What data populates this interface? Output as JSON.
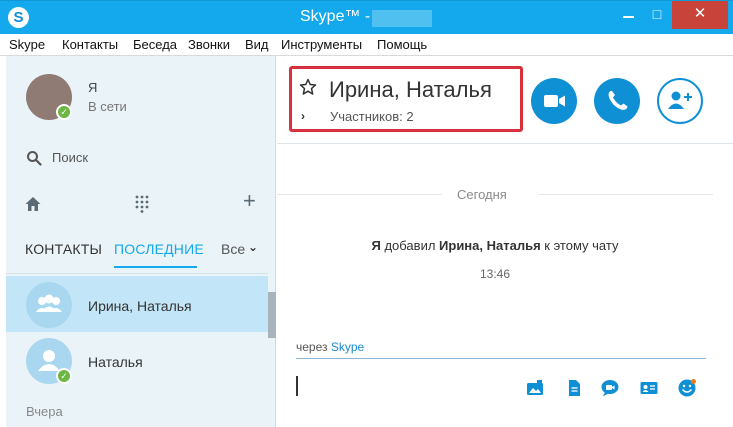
{
  "window": {
    "title": "Skype™ -",
    "app_icon_letter": "S",
    "minimize_label": "",
    "maximize_label": "□",
    "close_label": "✕"
  },
  "menu": {
    "items": [
      "Skype",
      "Контакты",
      "Беседа",
      "Звонки",
      "Вид",
      "Инструменты",
      "Помощь"
    ]
  },
  "profile": {
    "name": "Я",
    "status": "В сети"
  },
  "search": {
    "label": "Поиск"
  },
  "sidebar": {
    "tabs": {
      "contacts": "КОНТАКТЫ",
      "recent": "ПОСЛЕДНИЕ"
    },
    "filter": "Все",
    "recent_items": [
      {
        "name": "Ирина, Наталья",
        "selected": true
      },
      {
        "name": "Наталья",
        "selected": false
      }
    ],
    "section_yesterday": "Вчера"
  },
  "conversation": {
    "title": "Ирина, Наталья",
    "participants": "Участников: 2"
  },
  "chat": {
    "day_label": "Сегодня",
    "event_actor": "Я",
    "event_middle": " добавил ",
    "event_names": "Ирина, Наталья",
    "event_suffix": " к этому чату",
    "event_time": "13:46",
    "via_prefix": "через ",
    "via_link": "Skype"
  },
  "colors": {
    "brand": "#13a9ec",
    "action_button": "#1090d4",
    "highlight_border": "#d9303d",
    "online_status": "#6cb644"
  },
  "icons": {
    "video_call": "video-camera-icon",
    "audio_call": "phone-icon",
    "add_people": "add-person-icon",
    "favorite": "star-icon",
    "home": "home-icon",
    "dialpad": "dialpad-icon",
    "search": "search-icon"
  }
}
